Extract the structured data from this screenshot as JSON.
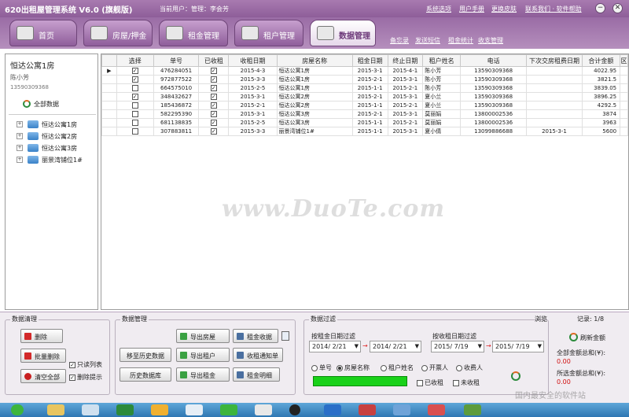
{
  "titlebar": {
    "title": "620出租屋管理系统 V6.0 (旗舰版)",
    "user_label": "当前用户：管理：李会芳",
    "links": [
      "系统选项",
      "用户手册",
      "更换皮肤",
      "联系我们 · 软件帮助"
    ],
    "min": "−",
    "close": "✕"
  },
  "nav": {
    "tabs": [
      {
        "label": "首页",
        "active": false
      },
      {
        "label": "房屋/押金",
        "active": false
      },
      {
        "label": "租金管理",
        "active": false
      },
      {
        "label": "租户管理",
        "active": false
      },
      {
        "label": "数据管理",
        "active": true
      }
    ],
    "sublinks": [
      "备忘录",
      "发送短信",
      "租金统计",
      "收支管理"
    ]
  },
  "left": {
    "title": "恒达公寓1房",
    "name": "陈小芳",
    "phone": "13590309368",
    "all_data": "全部数据",
    "tree": [
      "恒达公寓1房",
      "恒达公寓2房",
      "恒达公寓3房",
      "丽景湾铺位1#"
    ]
  },
  "table": {
    "columns": [
      "选择",
      "单号",
      "已收租",
      "收租日期",
      "房屋名称",
      "租金日期",
      "终止日期",
      "租户姓名",
      "电话",
      "下次交房租费日期",
      "合计金额",
      "区"
    ],
    "rows": [
      {
        "sel": true,
        "id": "476284051",
        "paid": true,
        "date": "2015-4-3",
        "house": "恒达公寓1房",
        "start": "2015-3-1",
        "end": "2015-4-1",
        "tenant": "陈小芳",
        "phone": "13590309368",
        "next": "",
        "total": "4022.95",
        "current": true
      },
      {
        "sel": true,
        "id": "972877522",
        "paid": true,
        "date": "2015-3-3",
        "house": "恒达公寓1房",
        "start": "2015-2-1",
        "end": "2015-3-1",
        "tenant": "陈小芳",
        "phone": "13590309368",
        "next": "",
        "total": "3821.5",
        "current": false
      },
      {
        "sel": false,
        "id": "664575010",
        "paid": true,
        "date": "2015-2-5",
        "house": "恒达公寓1房",
        "start": "2015-1-1",
        "end": "2015-2-1",
        "tenant": "陈小芳",
        "phone": "13590309368",
        "next": "",
        "total": "3839.05",
        "current": false
      },
      {
        "sel": true,
        "id": "348432627",
        "paid": true,
        "date": "2015-3-1",
        "house": "恒达公寓2房",
        "start": "2015-2-1",
        "end": "2015-3-1",
        "tenant": "夏小兰",
        "phone": "13590309368",
        "next": "",
        "total": "3896.25",
        "current": false
      },
      {
        "sel": false,
        "id": "185436872",
        "paid": true,
        "date": "2015-2-1",
        "house": "恒达公寓2房",
        "start": "2015-1-1",
        "end": "2015-2-1",
        "tenant": "夏小兰",
        "phone": "13590309368",
        "next": "",
        "total": "4292.5",
        "current": false
      },
      {
        "sel": false,
        "id": "582295390",
        "paid": true,
        "date": "2015-3-1",
        "house": "恒达公寓3房",
        "start": "2015-2-1",
        "end": "2015-3-1",
        "tenant": "莫丽娟",
        "phone": "13800002536",
        "next": "",
        "total": "3874",
        "current": false
      },
      {
        "sel": false,
        "id": "681138835",
        "paid": true,
        "date": "2015-2-5",
        "house": "恒达公寓3房",
        "start": "2015-1-1",
        "end": "2015-2-1",
        "tenant": "莫丽娟",
        "phone": "13800002536",
        "next": "",
        "total": "3963",
        "current": false
      },
      {
        "sel": false,
        "id": "307883811",
        "paid": true,
        "date": "2015-3-3",
        "house": "丽景湾铺位1#",
        "start": "2015-1-1",
        "end": "2015-3-1",
        "tenant": "夏小倩",
        "phone": "13099886688",
        "next": "2015-3-1",
        "total": "5600",
        "current": false
      }
    ]
  },
  "watermark": "www.DuoTe.com",
  "cleanup": {
    "title": "数据清理",
    "delete": "删除",
    "batch_delete": "批量删除",
    "clear_all": "清空全部",
    "readonly_list": "只读列表",
    "delete_prompt": "删除提示"
  },
  "datamgr": {
    "title": "数据管理",
    "move_history": "移至历史数据",
    "history_db": "历史数据库",
    "export_house": "导出房屋",
    "export_tenant": "导出租户",
    "export_rent": "导出租金",
    "rent_receipt": "租金收据",
    "rent_notice": "收租通知单",
    "rent_detail": "租金明细"
  },
  "filter": {
    "title": "数据过滤",
    "by_rent_date": "按租金日期过滤",
    "by_collect_date": "按收租日期过滤",
    "rent_from": "2014/ 2/21",
    "rent_to": "2014/ 2/21",
    "collect_from": "2015/ 7/19",
    "collect_to": "2015/ 7/19",
    "options": [
      "单号",
      "房屋名称",
      "租户姓名",
      "开票人",
      "收费人"
    ],
    "selected_option": 1,
    "chk_paid": "已收租",
    "chk_unpaid": "未收租"
  },
  "status": {
    "browse": "浏览",
    "record": "记录: 1/8",
    "refresh": "刷新金额",
    "total_label": "全部金额总和(¥):",
    "total_value": "0.00",
    "selected_label": "所选金额总和(¥):",
    "selected_value": "0.00"
  },
  "footer_mark": "国内最安全的软件站"
}
